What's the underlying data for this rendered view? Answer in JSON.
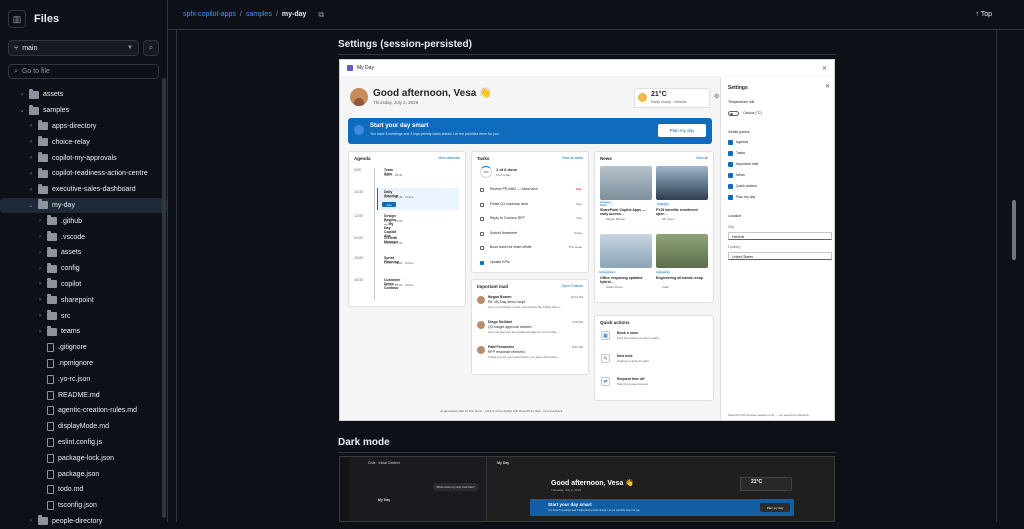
{
  "sidebar": {
    "title": "Files",
    "branch": "main",
    "goto_placeholder": "Go to file",
    "tree": [
      {
        "label": "assets",
        "type": "folder",
        "depth": 0,
        "expanded": false
      },
      {
        "label": "samples",
        "type": "folder",
        "depth": 0,
        "expanded": true
      },
      {
        "label": "apps-directory",
        "type": "folder",
        "depth": 1,
        "expanded": false
      },
      {
        "label": "choice-relay",
        "type": "folder",
        "depth": 1,
        "expanded": false
      },
      {
        "label": "copilot-my-approvals",
        "type": "folder",
        "depth": 1,
        "expanded": false
      },
      {
        "label": "copilot-readiness-action-centre",
        "type": "folder",
        "depth": 1,
        "expanded": false
      },
      {
        "label": "executive-sales-dashboard",
        "type": "folder",
        "depth": 1,
        "expanded": false
      },
      {
        "label": "my-day",
        "type": "folder",
        "depth": 1,
        "expanded": true,
        "active": true
      },
      {
        "label": ".github",
        "type": "folder",
        "depth": 2,
        "expanded": false
      },
      {
        "label": ".vscode",
        "type": "folder",
        "depth": 2,
        "expanded": false
      },
      {
        "label": "assets",
        "type": "folder",
        "depth": 2,
        "expanded": false
      },
      {
        "label": "config",
        "type": "folder",
        "depth": 2,
        "expanded": false
      },
      {
        "label": "copilot",
        "type": "folder",
        "depth": 2,
        "expanded": false
      },
      {
        "label": "sharepoint",
        "type": "folder",
        "depth": 2,
        "expanded": false
      },
      {
        "label": "src",
        "type": "folder",
        "depth": 2,
        "expanded": false
      },
      {
        "label": "teams",
        "type": "folder",
        "depth": 2,
        "expanded": false
      },
      {
        "label": ".gitignore",
        "type": "file",
        "depth": 2
      },
      {
        "label": ".npmignore",
        "type": "file",
        "depth": 2
      },
      {
        "label": ".yo-rc.json",
        "type": "file",
        "depth": 2
      },
      {
        "label": "README.md",
        "type": "file",
        "depth": 2
      },
      {
        "label": "agentic-creation-rules.md",
        "type": "file",
        "depth": 2
      },
      {
        "label": "displayMode.md",
        "type": "file",
        "depth": 2
      },
      {
        "label": "eslint.config.js",
        "type": "file",
        "depth": 2
      },
      {
        "label": "package-lock.json",
        "type": "file",
        "depth": 2
      },
      {
        "label": "package.json",
        "type": "file",
        "depth": 2
      },
      {
        "label": "todo.md",
        "type": "file",
        "depth": 2
      },
      {
        "label": "tsconfig.json",
        "type": "file",
        "depth": 2
      },
      {
        "label": "people-directory",
        "type": "folder",
        "depth": 1,
        "expanded": false
      }
    ]
  },
  "breadcrumb": {
    "repo": "spfx-copilot-apps",
    "folder": "samples",
    "current": "my-day",
    "sep": "/",
    "top_label": "Top"
  },
  "sections": {
    "settings_heading": "Settings (session-persisted)",
    "dark_heading": "Dark mode"
  },
  "shot": {
    "app_title": "My Day",
    "greeting": "Good afternoon, Vesa 👋",
    "date": "Thursday, July 2, 2026",
    "weather": {
      "temp": "21°C",
      "desc": "Partly cloudy · Helsinki"
    },
    "banner": {
      "title": "Start your day smart",
      "sub": "You have 5 meetings and 3 high-priority tasks ahead. Let me prioritize them for you.",
      "button": "Plan my day"
    },
    "agenda": {
      "title": "Agenda",
      "action": "View calendar",
      "items": [
        {
          "time": "9:00",
          "title": "Team Sync",
          "sub": "09:00 – 09:30"
        },
        {
          "time": "10:30",
          "title": "Daily Standup",
          "sub": "10:30 – 10:45 · Online",
          "join": "Join"
        },
        {
          "time": "12:00",
          "title": "Design Review — My Day Copilot App",
          "sub": "12:00 – 13:00"
        },
        {
          "time": "14:00",
          "title": "1:1 with Manager",
          "sub": "14:00 – 14:30"
        },
        {
          "time": "15:00",
          "title": "Sprint Planning",
          "sub": "15:00 – 16:00 · Online"
        },
        {
          "time": "16:30",
          "title": "Customer Demo — Contoso",
          "sub": "16:30 – 17:00 · Online"
        }
      ]
    },
    "tasks": {
      "title": "Tasks",
      "action": "View all tasks",
      "progress": "1 of 6 done",
      "progress_sub": "5 left today",
      "ring_label": "17%",
      "items": [
        {
          "label": "Review PR #482 — Initial view",
          "tag": "High",
          "high": true,
          "done": false
        },
        {
          "label": "Finish Q3 roadmap deck",
          "tag": "Due",
          "high": false,
          "done": false
        },
        {
          "label": "Reply to Contoso RFP",
          "tag": "Due",
          "high": false,
          "done": false
        },
        {
          "label": "Submit timesheet",
          "tag": "Today",
          "high": false,
          "done": false
        },
        {
          "label": "Book travel for team offsite",
          "tag": "This week",
          "high": false,
          "done": false
        },
        {
          "label": "Update KPIs",
          "tag": "",
          "high": false,
          "done": true
        }
      ]
    },
    "news": {
      "title": "News",
      "action": "View all",
      "items": [
        {
          "tag": "Company News",
          "title": "SharePoint Copilot Apps — early access…",
          "by": "Megan Bowen"
        },
        {
          "tag": "Highlights",
          "title": "FY26 benefits enrollment open…",
          "by": "HR Team"
        },
        {
          "tag": "Announcement",
          "title": "Office reopening updated hybrid…",
          "by": "Adele Vance"
        },
        {
          "tag": "Engineering",
          "title": "Engineering all-hands recap",
          "by": "Lidia"
        }
      ]
    },
    "mail": {
      "title": "Important mail",
      "action": "Open Outlook",
      "items": [
        {
          "name": "Megan Bowen",
          "subject": "Re: My Day demo script",
          "preview": "Let's run through it once more before the Friday demo…",
          "time": "10:12 AM"
        },
        {
          "name": "Diego Siciliani",
          "subject": "Q3 budget approval needed",
          "preview": "Can you approve the updated budget by end of day…",
          "time": "9:48 AM"
        },
        {
          "name": "Patti Fernandez",
          "subject": "RFP response received",
          "preview": "Thank you for your submission, our team will review…",
          "time": "8:30 AM"
        }
      ]
    },
    "quick": {
      "title": "Quick actions",
      "items": [
        {
          "title": "Book a room",
          "sub": "Find and reserve a room nearby"
        },
        {
          "title": "New note",
          "sub": "Capture a quick thought"
        },
        {
          "title": "Request time off",
          "sub": "Submit a leave request"
        }
      ]
    },
    "footer": "AI-generated data for this demo · Click to show details with SharePoint data · Give feedback",
    "settings": {
      "title": "Settings",
      "unit_label": "Temperature unit",
      "unit_value": "Celsius (°C)",
      "panels_label": "Visible panels",
      "panels": [
        "Agenda",
        "Tasks",
        "Important mail",
        "News",
        "Quick actions",
        "Plan my day"
      ],
      "location_label": "Location",
      "city_label": "City",
      "city_value": "Helsinki",
      "country_label": "Country",
      "country_value": "United States",
      "footnote": "Saved in this browser session only — not saved permanently"
    }
  },
  "dark": {
    "app_title": "My Day",
    "chat_header": "Chat · Initial Context",
    "chat_item": "My Day",
    "bubble": "What does my day look like?",
    "greeting": "Good afternoon, Vesa 👋",
    "date": "Thursday, July 2, 2026",
    "temp": "21°C",
    "banner_title": "Start your day smart",
    "banner_sub": "You have 5 meetings and 3 high-priority tasks ahead. Let me prioritize them for you.",
    "banner_button": "Plan my day"
  },
  "colors": {
    "accent": "#0f6cbd",
    "link": "#4493f8",
    "bg": "#0d1117"
  }
}
